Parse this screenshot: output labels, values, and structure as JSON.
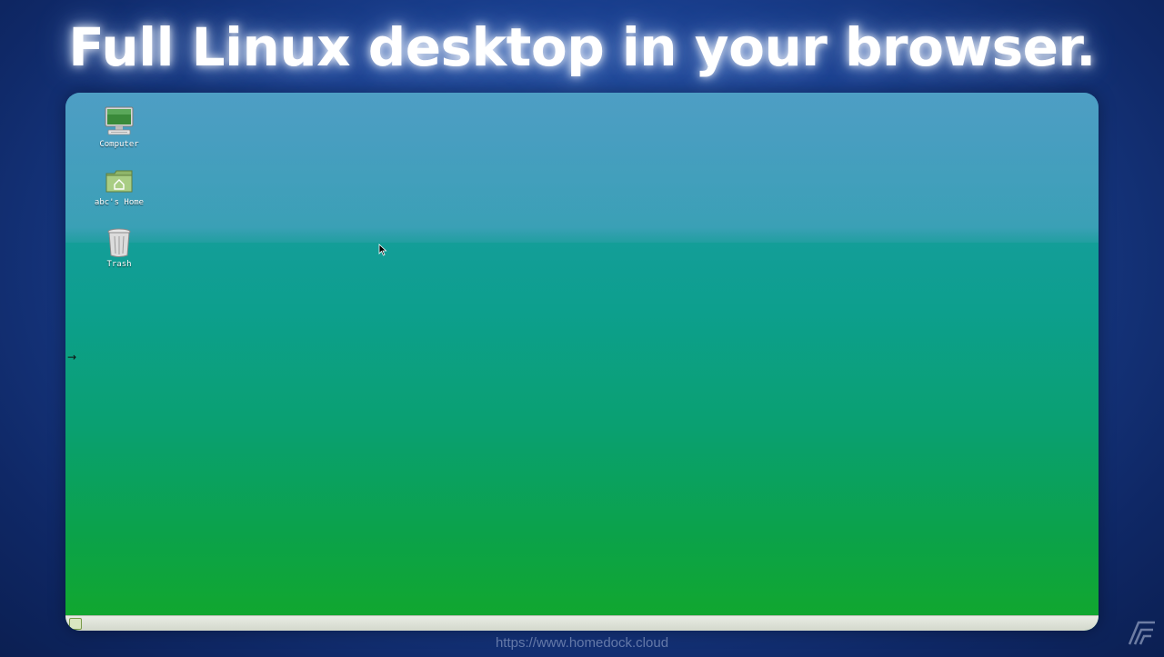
{
  "headline": "Full Linux desktop in your browser.",
  "desktop": {
    "icons": [
      {
        "label": "Computer",
        "icon": "computer-icon"
      },
      {
        "label": "abc's Home",
        "icon": "home-folder-icon"
      },
      {
        "label": "Trash",
        "icon": "trash-icon"
      }
    ],
    "side_arrow": "→"
  },
  "footer": {
    "url": "https://www.homedock.cloud"
  },
  "colors": {
    "background": "#1a3f8f",
    "desktop_top": "#3f9bc0",
    "desktop_bottom": "#12a82a",
    "taskbar": "#e0e4da"
  }
}
